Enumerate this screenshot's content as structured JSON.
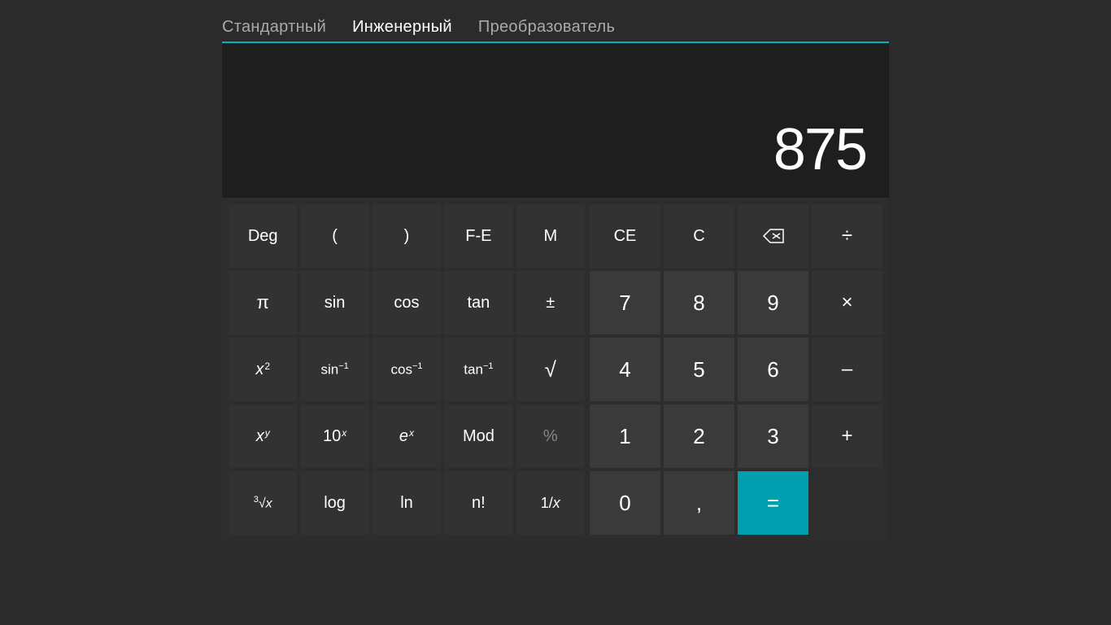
{
  "nav": {
    "items": [
      {
        "label": "Стандартный",
        "active": false
      },
      {
        "label": "Инженерный",
        "active": true
      },
      {
        "label": "Преобразователь",
        "active": false
      }
    ]
  },
  "display": {
    "value": "875"
  },
  "left_buttons": [
    {
      "label": "Deg",
      "type": "dark"
    },
    {
      "label": "(",
      "type": "dark"
    },
    {
      "label": ")",
      "type": "dark"
    },
    {
      "label": "F-E",
      "type": "dark"
    },
    {
      "label": "M",
      "type": "dark"
    },
    {
      "label": "π",
      "type": "dark",
      "italic": false
    },
    {
      "label": "sin",
      "type": "dark"
    },
    {
      "label": "cos",
      "type": "dark"
    },
    {
      "label": "tan",
      "type": "dark"
    },
    {
      "label": "±",
      "type": "dark"
    },
    {
      "label": "x²",
      "type": "dark",
      "special": "x_sq"
    },
    {
      "label": "sin⁻¹",
      "type": "dark",
      "special": "sin_inv"
    },
    {
      "label": "cos⁻¹",
      "type": "dark",
      "special": "cos_inv"
    },
    {
      "label": "tan⁻¹",
      "type": "dark",
      "special": "tan_inv"
    },
    {
      "label": "√",
      "type": "dark"
    },
    {
      "label": "xʸ",
      "type": "dark",
      "special": "x_y"
    },
    {
      "label": "10ˣ",
      "type": "dark",
      "special": "ten_x"
    },
    {
      "label": "eˣ",
      "type": "dark",
      "special": "e_x"
    },
    {
      "label": "Mod",
      "type": "dark"
    },
    {
      "label": "%",
      "type": "dark"
    },
    {
      "label": "∛x",
      "type": "dark",
      "special": "cbrt_x"
    },
    {
      "label": "log",
      "type": "dark"
    },
    {
      "label": "ln",
      "type": "dark"
    },
    {
      "label": "n!",
      "type": "dark"
    },
    {
      "label": "1/x",
      "type": "dark",
      "special": "recip"
    }
  ],
  "right_buttons": [
    {
      "label": "CE",
      "type": "dark"
    },
    {
      "label": "C",
      "type": "dark"
    },
    {
      "label": "⌫",
      "type": "dark"
    },
    {
      "label": "÷",
      "type": "dark"
    },
    {
      "label": "7",
      "type": "num"
    },
    {
      "label": "8",
      "type": "num"
    },
    {
      "label": "9",
      "type": "num"
    },
    {
      "label": "×",
      "type": "dark"
    },
    {
      "label": "4",
      "type": "num"
    },
    {
      "label": "5",
      "type": "num"
    },
    {
      "label": "6",
      "type": "num"
    },
    {
      "label": "–",
      "type": "dark"
    },
    {
      "label": "1",
      "type": "num"
    },
    {
      "label": "2",
      "type": "num"
    },
    {
      "label": "3",
      "type": "num"
    },
    {
      "label": "+",
      "type": "dark"
    },
    {
      "label": "0",
      "type": "num"
    },
    {
      "label": ",",
      "type": "num"
    },
    {
      "label": "=",
      "type": "teal"
    }
  ],
  "colors": {
    "accent": "#009faf",
    "bg": "#2b2b2b",
    "btn_dark": "#323232",
    "btn_normal": "#3a3a3a",
    "display_bg": "#1e1e1e"
  }
}
